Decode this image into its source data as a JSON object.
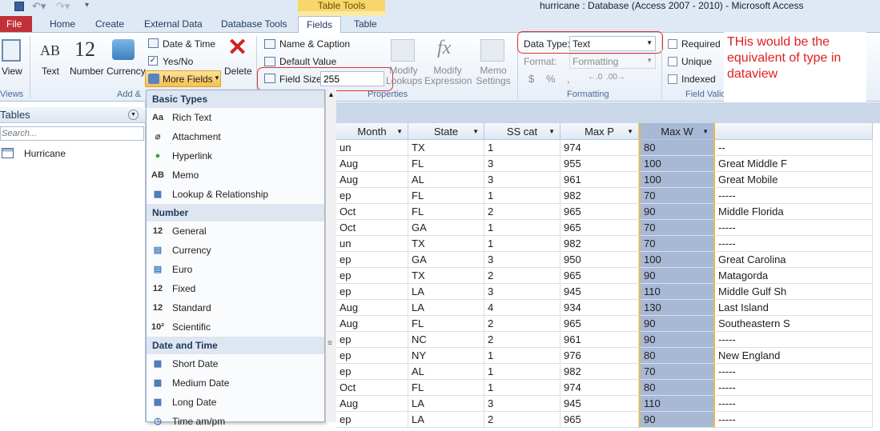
{
  "window": {
    "title": "hurricane : Database (Access 2007 - 2010)  -  Microsoft Access",
    "context_tab_group": "Table Tools"
  },
  "tabs": [
    {
      "label": "File"
    },
    {
      "label": "Home"
    },
    {
      "label": "Create"
    },
    {
      "label": "External Data"
    },
    {
      "label": "Database Tools"
    },
    {
      "label": "Fields"
    },
    {
      "label": "Table"
    }
  ],
  "ribbon": {
    "views_label": "Views",
    "view_button": "View",
    "text_button": "Text",
    "number_button": "Number",
    "currency_button": "Currency",
    "date_time": "Date & Time",
    "yes_no": "Yes/No",
    "more_fields": "More Fields",
    "delete_button": "Delete",
    "add_delete_label": "Add &",
    "name_caption": "Name & Caption",
    "default_value": "Default Value",
    "field_size_label": "Field Size",
    "field_size_value": "255",
    "modify_lookups": "Modify Lookups",
    "modify_expression": "Modify Expression",
    "memo_settings": "Memo Settings",
    "properties_label": "Properties",
    "data_type_label": "Data Type:",
    "data_type_value": "Text",
    "format_label": "Format:",
    "format_value": "Formatting",
    "formatting_label": "Formatting",
    "required": "Required",
    "unique": "Unique",
    "indexed": "Indexed",
    "field_validation_label": "Field Valid",
    "number_icon": "12",
    "text_icon": "AB"
  },
  "annotation": "THis would be the equivalent of type in dataview",
  "nav": {
    "header": "Tables",
    "search_placeholder": "Search...",
    "items": [
      {
        "label": "Hurricane"
      }
    ]
  },
  "menu": {
    "sections": [
      {
        "header": "Basic Types",
        "items": [
          "Rich Text",
          "Attachment",
          "Hyperlink",
          "Memo",
          "Lookup & Relationship"
        ]
      },
      {
        "header": "Number",
        "items": [
          "General",
          "Currency",
          "Euro",
          "Fixed",
          "Standard",
          "Scientific"
        ]
      },
      {
        "header": "Date and Time",
        "items": [
          "Short Date",
          "Medium Date",
          "Long Date",
          "Time am/pm"
        ]
      }
    ]
  },
  "grid": {
    "columns": [
      "Month",
      "State",
      "SS cat",
      "Max P",
      "Max W",
      ""
    ],
    "rows": [
      [
        "un",
        "TX",
        "1",
        "974",
        "80",
        "--"
      ],
      [
        "Aug",
        "FL",
        "3",
        "955",
        "100",
        "Great Middle F"
      ],
      [
        "Aug",
        "AL",
        "3",
        "961",
        "100",
        "Great Mobile"
      ],
      [
        "ep",
        "FL",
        "1",
        "982",
        "70",
        "-----"
      ],
      [
        "Oct",
        "FL",
        "2",
        "965",
        "90",
        "Middle Florida"
      ],
      [
        "Oct",
        "GA",
        "1",
        "965",
        "70",
        "-----"
      ],
      [
        "un",
        "TX",
        "1",
        "982",
        "70",
        "-----"
      ],
      [
        "ep",
        "GA",
        "3",
        "950",
        "100",
        "Great Carolina"
      ],
      [
        "ep",
        "TX",
        "2",
        "965",
        "90",
        "Matagorda"
      ],
      [
        "ep",
        "LA",
        "3",
        "945",
        "110",
        "Middle Gulf Sh"
      ],
      [
        "Aug",
        "LA",
        "4",
        "934",
        "130",
        "Last Island"
      ],
      [
        "Aug",
        "FL",
        "2",
        "965",
        "90",
        "Southeastern S"
      ],
      [
        "ep",
        "NC",
        "2",
        "961",
        "90",
        "-----"
      ],
      [
        "ep",
        "NY",
        "1",
        "976",
        "80",
        "New England"
      ],
      [
        "ep",
        "AL",
        "1",
        "982",
        "70",
        "-----"
      ],
      [
        "Oct",
        "FL",
        "1",
        "974",
        "80",
        "-----"
      ],
      [
        "Aug",
        "LA",
        "3",
        "945",
        "110",
        "-----"
      ],
      [
        "ep",
        "LA",
        "2",
        "965",
        "90",
        "-----"
      ]
    ]
  }
}
